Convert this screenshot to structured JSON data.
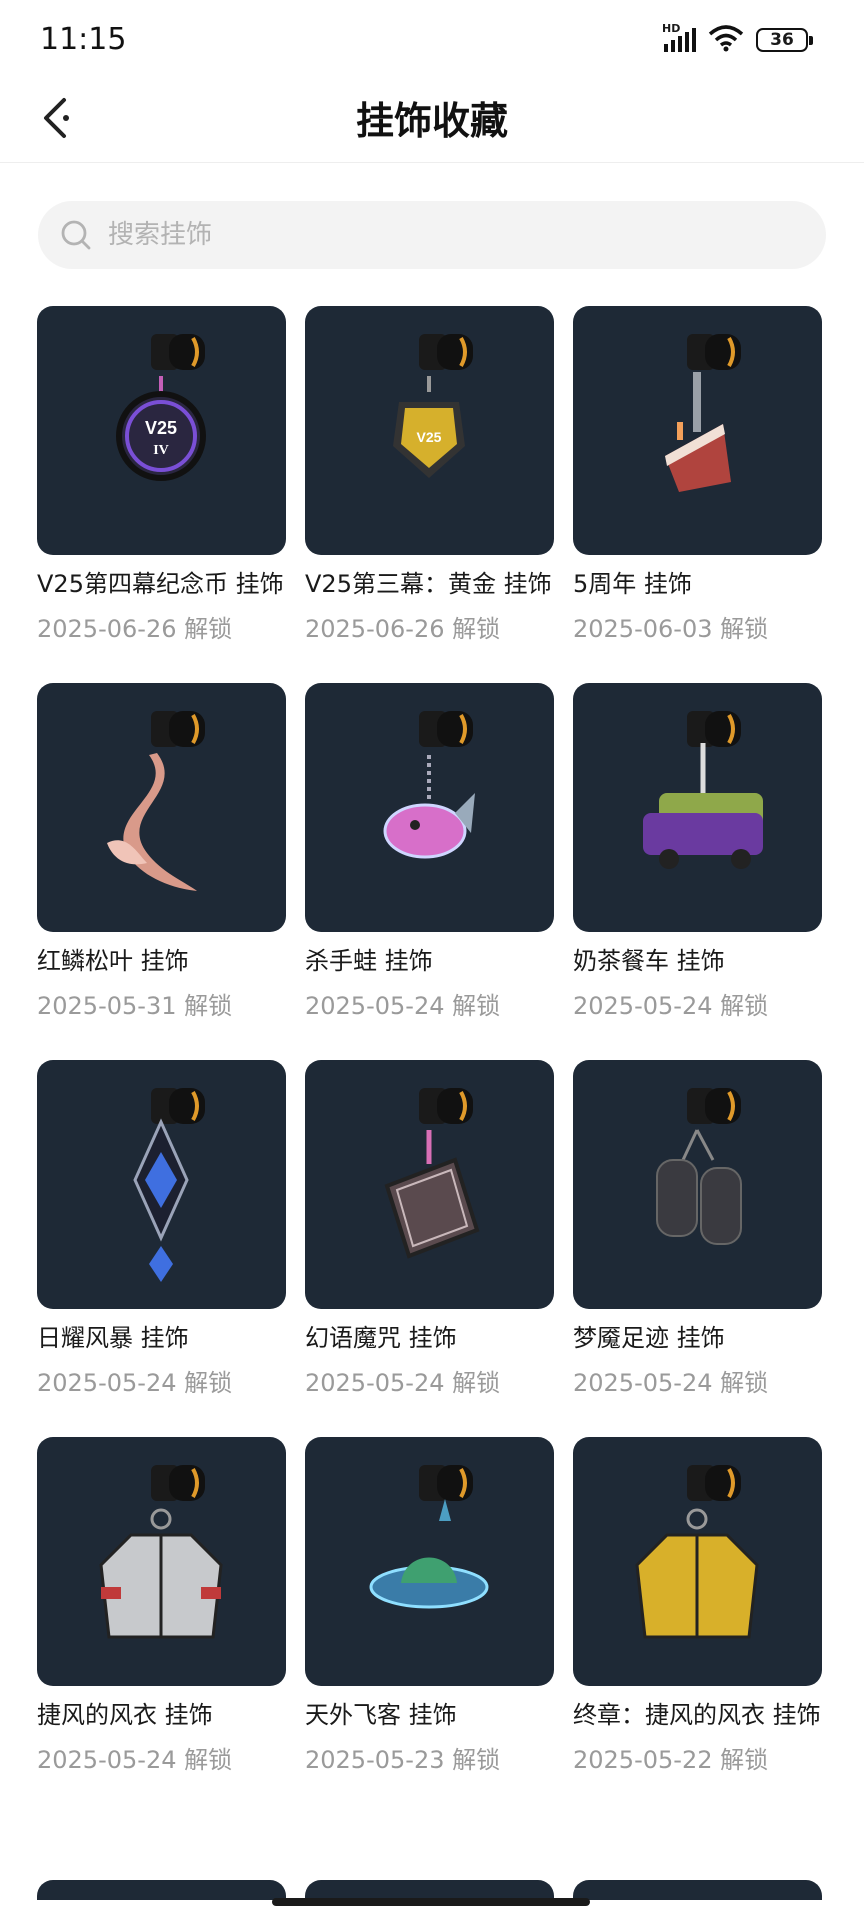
{
  "status": {
    "time": "11:15",
    "network": "HD",
    "battery": "36"
  },
  "header": {
    "title": "挂饰收藏"
  },
  "search": {
    "placeholder": "搜索挂饰"
  },
  "charms": [
    {
      "name": "V25第四幕纪念币 挂饰",
      "date": "2025-06-26 解锁",
      "icon": "v25-act4-coin-charm",
      "accent": "#7a4fd6",
      "mark": "V25",
      "sub": "IV"
    },
    {
      "name": "V25第三幕：黄金 挂饰",
      "date": "2025-06-26 解锁",
      "icon": "v25-act3-gold-charm",
      "accent": "#d6b02c",
      "mark": "V25"
    },
    {
      "name": "5周年 挂饰",
      "date": "2025-06-03 解锁",
      "icon": "cake-fork-charm",
      "accent": "#b0443e"
    },
    {
      "name": "红鳞松叶 挂饰",
      "date": "2025-05-31 解锁",
      "icon": "koi-fish-charm",
      "accent": "#d99a8a"
    },
    {
      "name": "杀手蛙 挂饰",
      "date": "2025-05-24 解锁",
      "icon": "killer-frog-charm",
      "accent": "#d76fc9"
    },
    {
      "name": "奶茶餐车 挂饰",
      "date": "2025-05-24 解锁",
      "icon": "tea-truck-charm",
      "accent": "#8fa84a"
    },
    {
      "name": "日耀风暴 挂饰",
      "date": "2025-05-24 解锁",
      "icon": "blue-crystal-charm",
      "accent": "#3f6fe0"
    },
    {
      "name": "幻语魔咒 挂饰",
      "date": "2025-05-24 解锁",
      "icon": "spellbook-charm",
      "accent": "#5a4a4e"
    },
    {
      "name": "梦魇足迹 挂饰",
      "date": "2025-05-24 解锁",
      "icon": "paw-boots-charm",
      "accent": "#3a3a40"
    },
    {
      "name": "捷风的风衣 挂饰",
      "date": "2025-05-24 解锁",
      "icon": "jacket-charm",
      "accent": "#c7c9cc"
    },
    {
      "name": "天外飞客 挂饰",
      "date": "2025-05-23 解锁",
      "icon": "ufo-charm",
      "accent": "#4fa6d4"
    },
    {
      "name": "终章：捷风的风衣 挂饰",
      "date": "2025-05-22 解锁",
      "icon": "gold-jacket-charm",
      "accent": "#d8b02a"
    }
  ]
}
